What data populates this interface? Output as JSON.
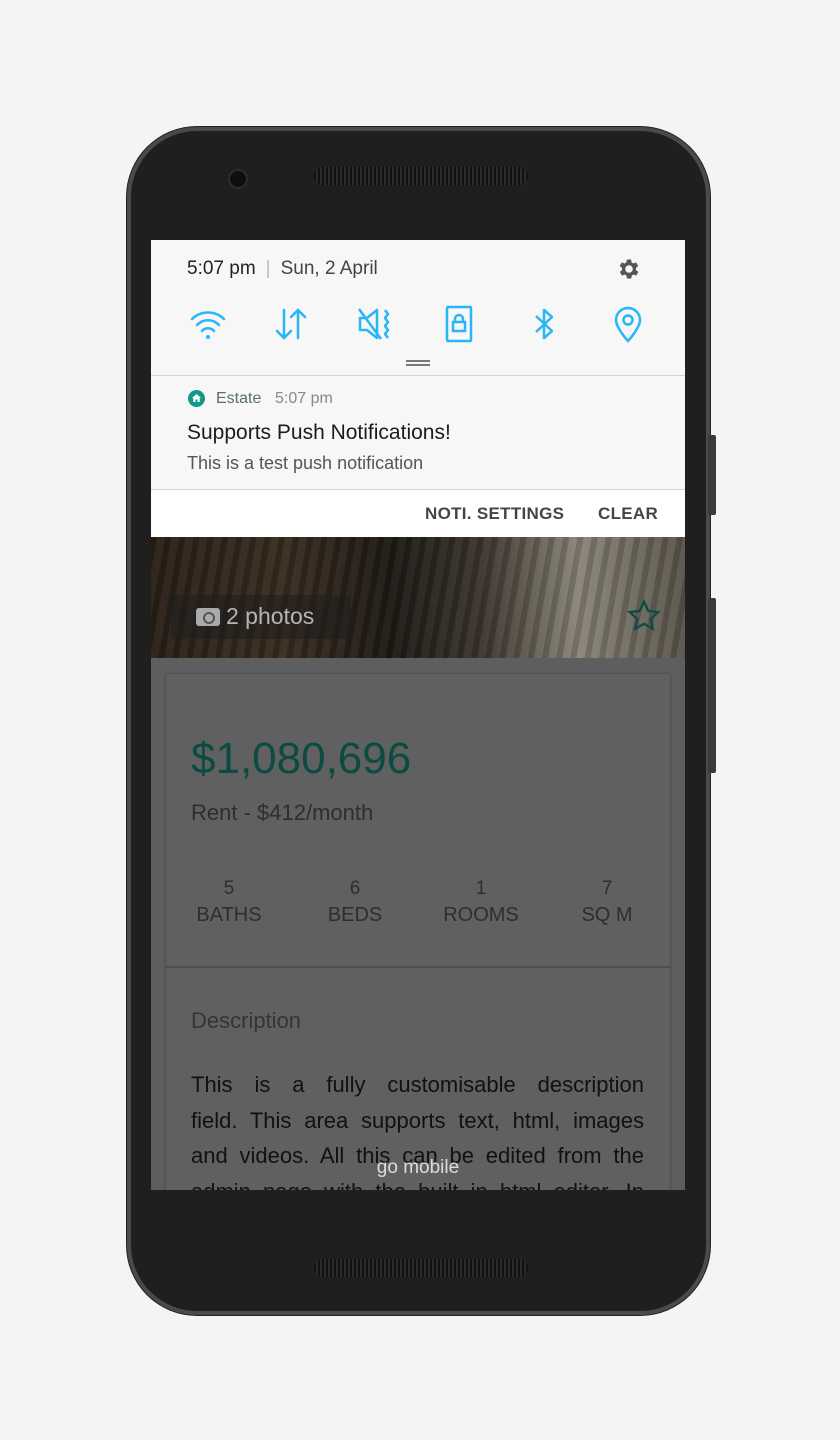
{
  "status_bar": {
    "time": "5:07 pm",
    "date": "Sun, 2 April"
  },
  "quick_settings": [
    {
      "icon": "wifi-icon"
    },
    {
      "icon": "data-transfer-icon"
    },
    {
      "icon": "mute-vibrate-icon"
    },
    {
      "icon": "screen-lock-icon"
    },
    {
      "icon": "bluetooth-icon"
    },
    {
      "icon": "location-icon"
    }
  ],
  "notification": {
    "app_name": "Estate",
    "time": "5:07 pm",
    "title": "Supports Push Notifications!",
    "text": "This is a test push notification",
    "actions": {
      "settings": "NOTI. SETTINGS",
      "clear": "CLEAR"
    }
  },
  "listing": {
    "photo_count": "2 photos",
    "price": "$1,080,696",
    "rent": "Rent - $412/month",
    "stats": [
      {
        "value": "5",
        "label": "BATHS"
      },
      {
        "value": "6",
        "label": "BEDS"
      },
      {
        "value": "1",
        "label": "ROOMS"
      },
      {
        "value": "7",
        "label": "SQ M"
      }
    ],
    "description_heading": "Description",
    "description_lines": [
      "This is a fully customisable description",
      "field. This area supports text, html, images",
      "and videos. All this can be edited from the",
      "admin page with the built in html editor. In"
    ]
  },
  "watermark": "go mobile",
  "colors": {
    "accent": "#29b6f6",
    "price": "#0a4b42",
    "app_icon": "#0f9b87"
  }
}
